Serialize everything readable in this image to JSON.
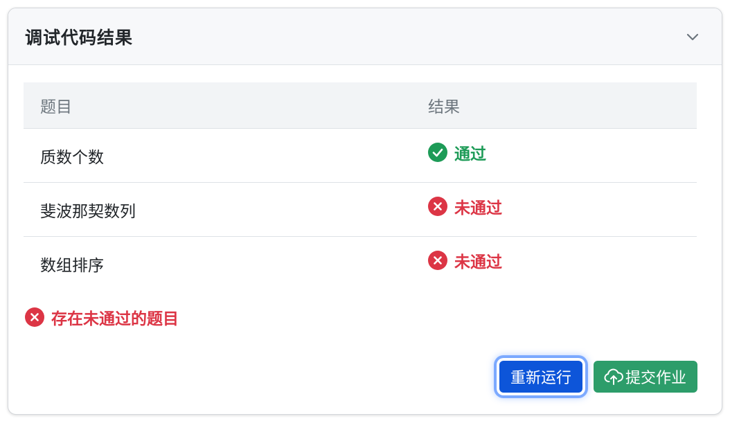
{
  "panel": {
    "title": "调试代码结果"
  },
  "table": {
    "headers": [
      "题目",
      "结果"
    ],
    "rows": [
      {
        "title": "质数个数",
        "result": "通过",
        "status": "pass"
      },
      {
        "title": "斐波那契数列",
        "result": "未通过",
        "status": "fail"
      },
      {
        "title": "数组排序",
        "result": "未通过",
        "status": "fail"
      }
    ]
  },
  "summary": {
    "text": "存在未通过的题目",
    "status": "fail"
  },
  "actions": {
    "rerun_label": "重新运行",
    "submit_label": "提交作业"
  },
  "colors": {
    "pass": "#1d9b57",
    "fail": "#dc3545",
    "primary": "#0d55d9",
    "success": "#2d9d6a"
  },
  "icons": {
    "collapse": "chevron-down-icon",
    "pass": "check-circle-icon",
    "fail": "x-circle-icon",
    "upload": "cloud-upload-icon"
  }
}
